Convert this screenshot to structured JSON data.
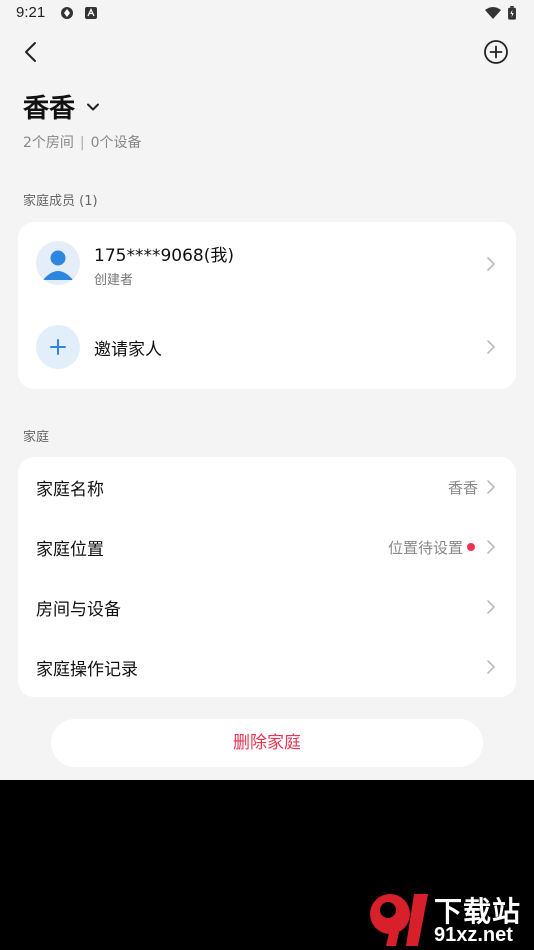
{
  "status_bar": {
    "time": "9:21"
  },
  "header": {
    "home_name": "香香",
    "rooms": "2个房间",
    "separator": "|",
    "devices": "0个设备"
  },
  "members_section": {
    "label": "家庭成员 (1)",
    "member": {
      "name": "175****9068(我)",
      "role": "创建者"
    },
    "invite_label": "邀请家人"
  },
  "home_section": {
    "label": "家庭",
    "rows": [
      {
        "label": "家庭名称",
        "value": "香香"
      },
      {
        "label": "家庭位置",
        "value": "位置待设置"
      },
      {
        "label": "房间与设备",
        "value": ""
      },
      {
        "label": "家庭操作记录",
        "value": ""
      }
    ]
  },
  "delete_button": "删除家庭",
  "watermark": {
    "text": "下载站",
    "domain": "91xz.net"
  },
  "colors": {
    "accent_red": "#e8344e",
    "accent_blue": "#2f86e0",
    "background": "#f4f4f4"
  }
}
